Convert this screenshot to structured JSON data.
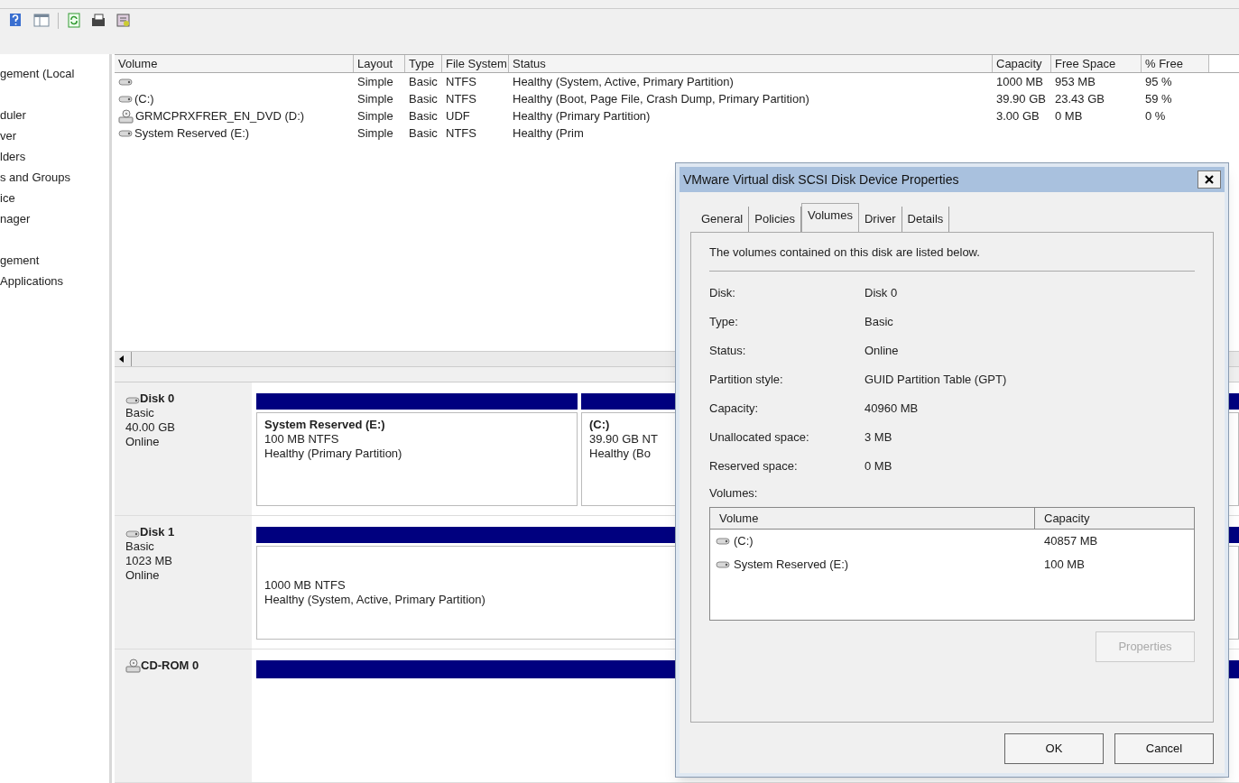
{
  "tree": {
    "items": [
      {
        "label": "gement (Local"
      },
      {
        "label": "duler",
        "gap_before": true
      },
      {
        "label": "ver"
      },
      {
        "label": "lders"
      },
      {
        "label": "s and Groups"
      },
      {
        "label": "ice"
      },
      {
        "label": "nager"
      },
      {
        "label": "gement",
        "gap_before": true
      },
      {
        "label": "Applications"
      }
    ]
  },
  "volume_table": {
    "columns": [
      "Volume",
      "Layout",
      "Type",
      "File System",
      "Status",
      "Capacity",
      "Free Space",
      "% Free"
    ],
    "rows": [
      {
        "kind": "disk",
        "cells": [
          "",
          "Simple",
          "Basic",
          "NTFS",
          "Healthy (System, Active, Primary Partition)",
          "1000 MB",
          "953 MB",
          "95 %"
        ]
      },
      {
        "kind": "disk",
        "cells": [
          "(C:)",
          "Simple",
          "Basic",
          "NTFS",
          "Healthy (Boot, Page File, Crash Dump, Primary Partition)",
          "39.90 GB",
          "23.43 GB",
          "59 %"
        ]
      },
      {
        "kind": "cdrom",
        "cells": [
          "GRMCPRXFRER_EN_DVD (D:)",
          "Simple",
          "Basic",
          "UDF",
          "Healthy (Primary Partition)",
          "3.00 GB",
          "0 MB",
          "0 %"
        ]
      },
      {
        "kind": "disk",
        "cells": [
          "System Reserved (E:)",
          "Simple",
          "Basic",
          "NTFS",
          "Healthy (Prim",
          "",
          "",
          ""
        ]
      }
    ]
  },
  "disks": [
    {
      "kind": "disk",
      "name": "Disk 0",
      "lines": [
        "Basic",
        "40.00 GB",
        "Online"
      ],
      "partitions": [
        {
          "title": "System Reserved  (E:)",
          "lines": [
            "100 MB NTFS",
            "Healthy (Primary Partition)"
          ]
        },
        {
          "title": "(C:)",
          "lines": [
            "39.90 GB NT",
            "Healthy (Bo"
          ]
        }
      ]
    },
    {
      "kind": "disk",
      "name": "Disk 1",
      "lines": [
        "Basic",
        "1023 MB",
        "Online"
      ],
      "partitions": [
        {
          "lines": [
            "1000 MB NTFS",
            "Healthy (System, Active, Primary Partition)"
          ]
        }
      ]
    },
    {
      "kind": "cdrom",
      "name": "CD-ROM 0"
    }
  ],
  "dialog": {
    "title": "VMware Virtual disk SCSI Disk Device Properties",
    "tabs": [
      {
        "label": "General",
        "selected": false
      },
      {
        "label": "Policies",
        "selected": false
      },
      {
        "label": "Volumes",
        "selected": true
      },
      {
        "label": "Driver",
        "selected": false
      },
      {
        "label": "Details",
        "selected": false
      }
    ],
    "description": "The volumes contained on this disk are listed below.",
    "properties": [
      {
        "label": "Disk:",
        "value": "Disk 0"
      },
      {
        "label": "Type:",
        "value": "Basic"
      },
      {
        "label": "Status:",
        "value": "Online"
      },
      {
        "label": "Partition style:",
        "value": "GUID Partition Table (GPT)"
      },
      {
        "label": "Capacity:",
        "value": "40960 MB"
      },
      {
        "label": "Unallocated space:",
        "value": "3 MB"
      },
      {
        "label": "Reserved space:",
        "value": "0 MB"
      }
    ],
    "volumes_label": "Volumes:",
    "volumes": {
      "columns": [
        "Volume",
        "Capacity"
      ],
      "rows": [
        [
          "(C:)",
          "40857 MB"
        ],
        [
          "System Reserved (E:)",
          "100 MB"
        ]
      ]
    },
    "buttons": [
      {
        "label": "Properties",
        "disabled": true
      },
      {
        "label": "OK",
        "disabled": false
      },
      {
        "label": "Cancel",
        "disabled": false
      }
    ]
  }
}
